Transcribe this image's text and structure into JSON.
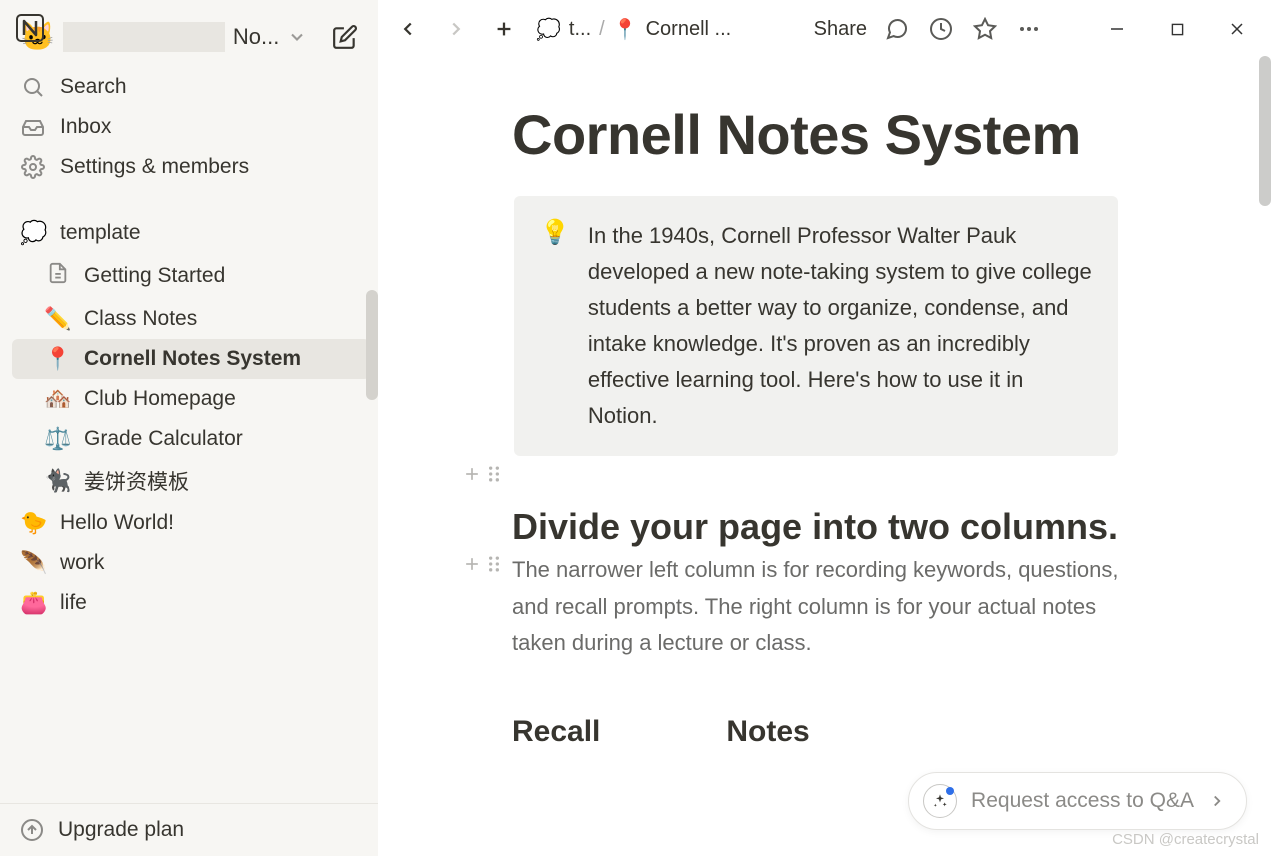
{
  "workspace": {
    "icon": "🐱",
    "label": "No..."
  },
  "sidebar": {
    "search": "Search",
    "inbox": "Inbox",
    "settings": "Settings & members",
    "upgrade": "Upgrade plan"
  },
  "pages": {
    "template": {
      "icon": "💭",
      "label": "template"
    },
    "getting_started": {
      "label": "Getting Started"
    },
    "class_notes": {
      "icon": "✏️",
      "label": "Class Notes"
    },
    "cornell": {
      "icon": "📍",
      "label": "Cornell Notes System"
    },
    "club": {
      "icon": "🏘️",
      "label": "Club Homepage"
    },
    "grade": {
      "icon": "⚖️",
      "label": "Grade Calculator"
    },
    "jiang": {
      "icon": "🐈‍⬛",
      "label": "姜饼资模板"
    },
    "hello": {
      "icon": "🐤",
      "label": "Hello World!"
    },
    "work": {
      "icon": "🪶",
      "label": "work"
    },
    "life": {
      "icon": "👛",
      "label": "life"
    }
  },
  "breadcrumb": {
    "parent_icon": "💭",
    "parent": "t...",
    "sep": "/",
    "page_icon": "📍",
    "page": "Cornell ..."
  },
  "topbar": {
    "share": "Share"
  },
  "content": {
    "title": "Cornell Notes System",
    "callout_icon": "💡",
    "callout": "In the 1940s, Cornell Professor Walter Pauk developed a new note-taking system to give college students a better way to organize, condense, and intake knowledge. It's proven as an incredibly effective learning tool. Here's how to use it in Notion.",
    "h2": "Divide your page into two columns.",
    "para": "The narrower left column is for recording keywords, questions, and recall prompts. The right column is for your actual notes taken during a lecture or class.",
    "col_recall": "Recall",
    "col_notes": "Notes"
  },
  "qa": {
    "label": "Request access to Q&A"
  },
  "watermark": "CSDN @createcrystal"
}
